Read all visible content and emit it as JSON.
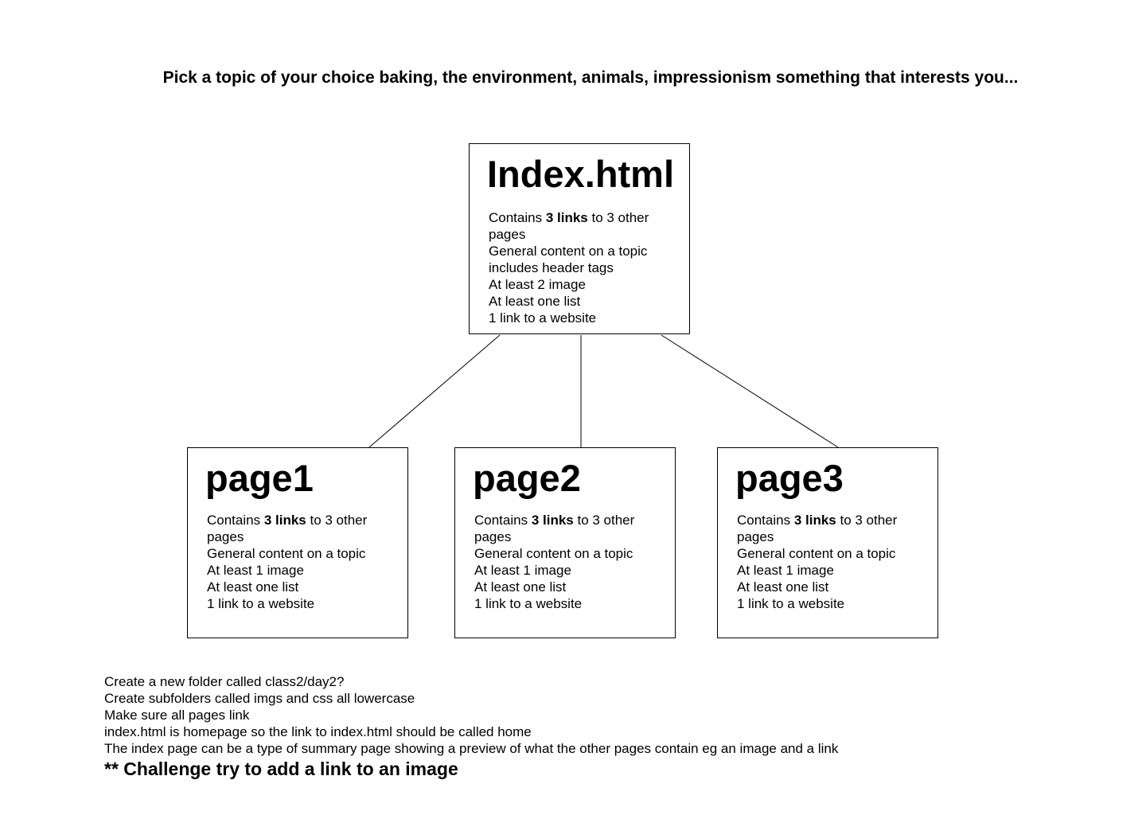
{
  "headline": "Pick a topic of your choice baking, the environment, animals, impressionism something that interests you...",
  "cards": {
    "index": {
      "title": "Index.html",
      "line1_pre": "Contains ",
      "line1_bold": "3 links",
      "line1_post": " to 3 other pages",
      "line2": "General content on a topic includes header tags",
      "line3": "At least 2 image",
      "line4": "At least one list",
      "line5": "1 link to a website"
    },
    "page1": {
      "title": "page1",
      "line1_pre": "Contains ",
      "line1_bold": "3 links",
      "line1_post": " to 3 other pages",
      "line2": "General content on a topic",
      "line3": "At least 1 image",
      "line4": "At least one list",
      "line5": "1 link to a website"
    },
    "page2": {
      "title": "page2",
      "line1_pre": "Contains ",
      "line1_bold": "3 links",
      "line1_post": " to 3 other pages",
      "line2": "General content on a topic",
      "line3": "At least 1 image",
      "line4": "At least one list",
      "line5": "1 link to a website"
    },
    "page3": {
      "title": "page3",
      "line1_pre": "Contains ",
      "line1_bold": "3 links",
      "line1_post": " to 3 other pages",
      "line2": "General content on a topic",
      "line3": "At least 1 image",
      "line4": "At least one list",
      "line5": "1 link to a website"
    }
  },
  "notes": [
    "Create a new folder called class2/day2?",
    "Create subfolders called imgs and css all lowercase",
    "Make sure all pages link",
    "index.html is homepage so the link to index.html should be called home",
    "The index page can be a type of summary page showing a preview of what the other pages contain eg an image and a link"
  ],
  "challenge": "** Challenge try to add a link to an image",
  "colors": {
    "background": "#ffffff",
    "text": "#000000",
    "border": "#000000"
  }
}
